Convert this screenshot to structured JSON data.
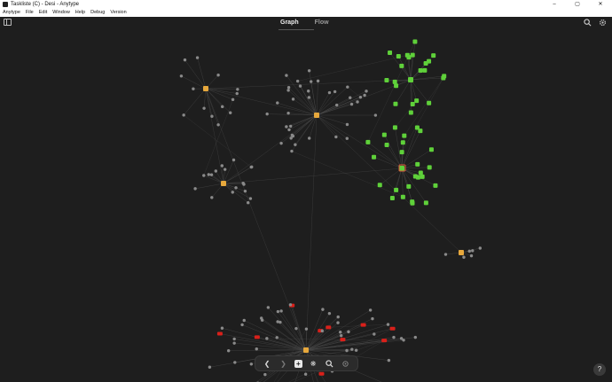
{
  "window": {
    "title": "Taskliste (C) - Desi - Anytype",
    "controls": [
      "–",
      "▢",
      "✕"
    ]
  },
  "menu": [
    "Anytype",
    "File",
    "Edit",
    "Window",
    "Help",
    "Debug",
    "Version"
  ],
  "tabs": [
    {
      "label": "Graph",
      "active": true
    },
    {
      "label": "Flow",
      "active": false
    }
  ],
  "colors": {
    "background": "#1e1e1e",
    "node": "#8a8a8a",
    "edge": "#4a4a4a",
    "task_node": "#5fd13a",
    "video_node": "#d9201a",
    "selected_node": "#e05a3a",
    "hub_node": "#e7a83c"
  },
  "icons": {
    "sidebar_toggle": "sidebar-toggle-icon",
    "search": "search-icon",
    "settings": "gear-icon",
    "help": "help-icon"
  },
  "toolbar": {
    "items": [
      "back-icon",
      "forward-icon",
      "plus-icon",
      "graph-icon",
      "search-icon",
      "settings-icon"
    ]
  },
  "help_label": "?"
}
